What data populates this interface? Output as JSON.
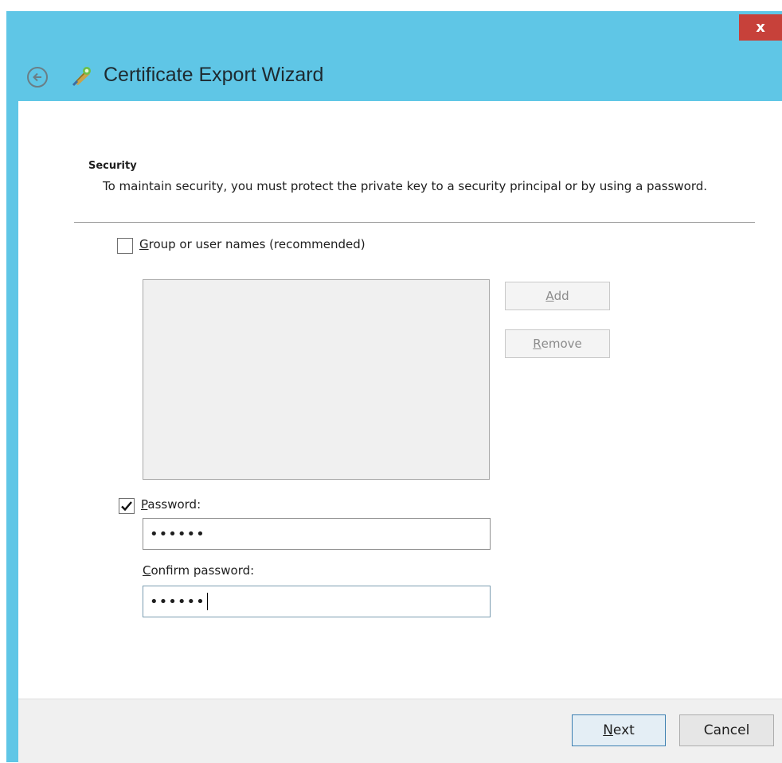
{
  "window": {
    "title": "Certificate Export Wizard",
    "close_label": "x",
    "accent_color": "#5fc6e6",
    "close_color": "#c7413a"
  },
  "section": {
    "heading": "Security",
    "description": "To maintain security, you must protect the private key to a security principal or by using a password."
  },
  "group_option": {
    "label_key": "G",
    "label_rest": "roup or user names (recommended)",
    "checked": false
  },
  "buttons": {
    "add_key": "A",
    "add_rest": "dd",
    "remove_key": "R",
    "remove_rest": "emove"
  },
  "password_option": {
    "label_key": "P",
    "label_rest": "assword:",
    "checked": true,
    "value": "••••••"
  },
  "confirm": {
    "label_key": "C",
    "label_rest": "onfirm password:",
    "value": "••••••"
  },
  "footer": {
    "next_key": "N",
    "next_rest": "ext",
    "cancel_label": "Cancel"
  }
}
